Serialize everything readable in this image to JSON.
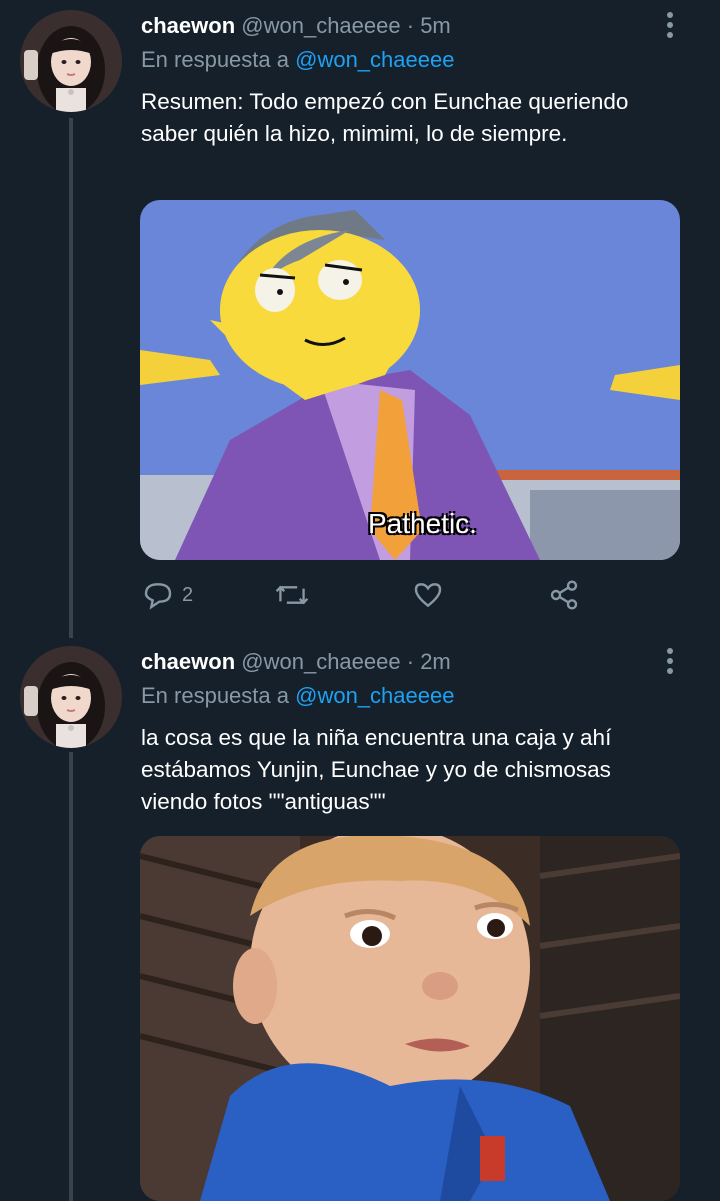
{
  "tweets": [
    {
      "name": "chaewon",
      "handle": "@won_chaeeee",
      "separator": "·",
      "time": "5m",
      "reply_prefix": "En respuesta a",
      "reply_to": "@won_chaeeee",
      "text": "Resumen: Todo empezó con Eunchae queriendo saber quién la hizo, mimimi, lo de siempre.",
      "media": {
        "caption": "Pathetic."
      },
      "actions": {
        "reply_count": "2"
      }
    },
    {
      "name": "chaewon",
      "handle": "@won_chaeeee",
      "separator": "·",
      "time": "2m",
      "reply_prefix": "En respuesta a",
      "reply_to": "@won_chaeeee",
      "text": "la cosa es que la niña encuentra una caja y ahí estábamos Yunjin, Eunchae y yo de chismosas viendo fotos \"\"antiguas\"\""
    }
  ],
  "icons": {
    "reply": "reply-icon",
    "retweet": "retweet-icon",
    "like": "heart-icon",
    "share": "share-icon",
    "more": "more-vertical-icon"
  },
  "colors": {
    "background": "#15202b",
    "secondary_text": "#8899a6",
    "link": "#1da1f2",
    "thread_line": "#38444d"
  }
}
